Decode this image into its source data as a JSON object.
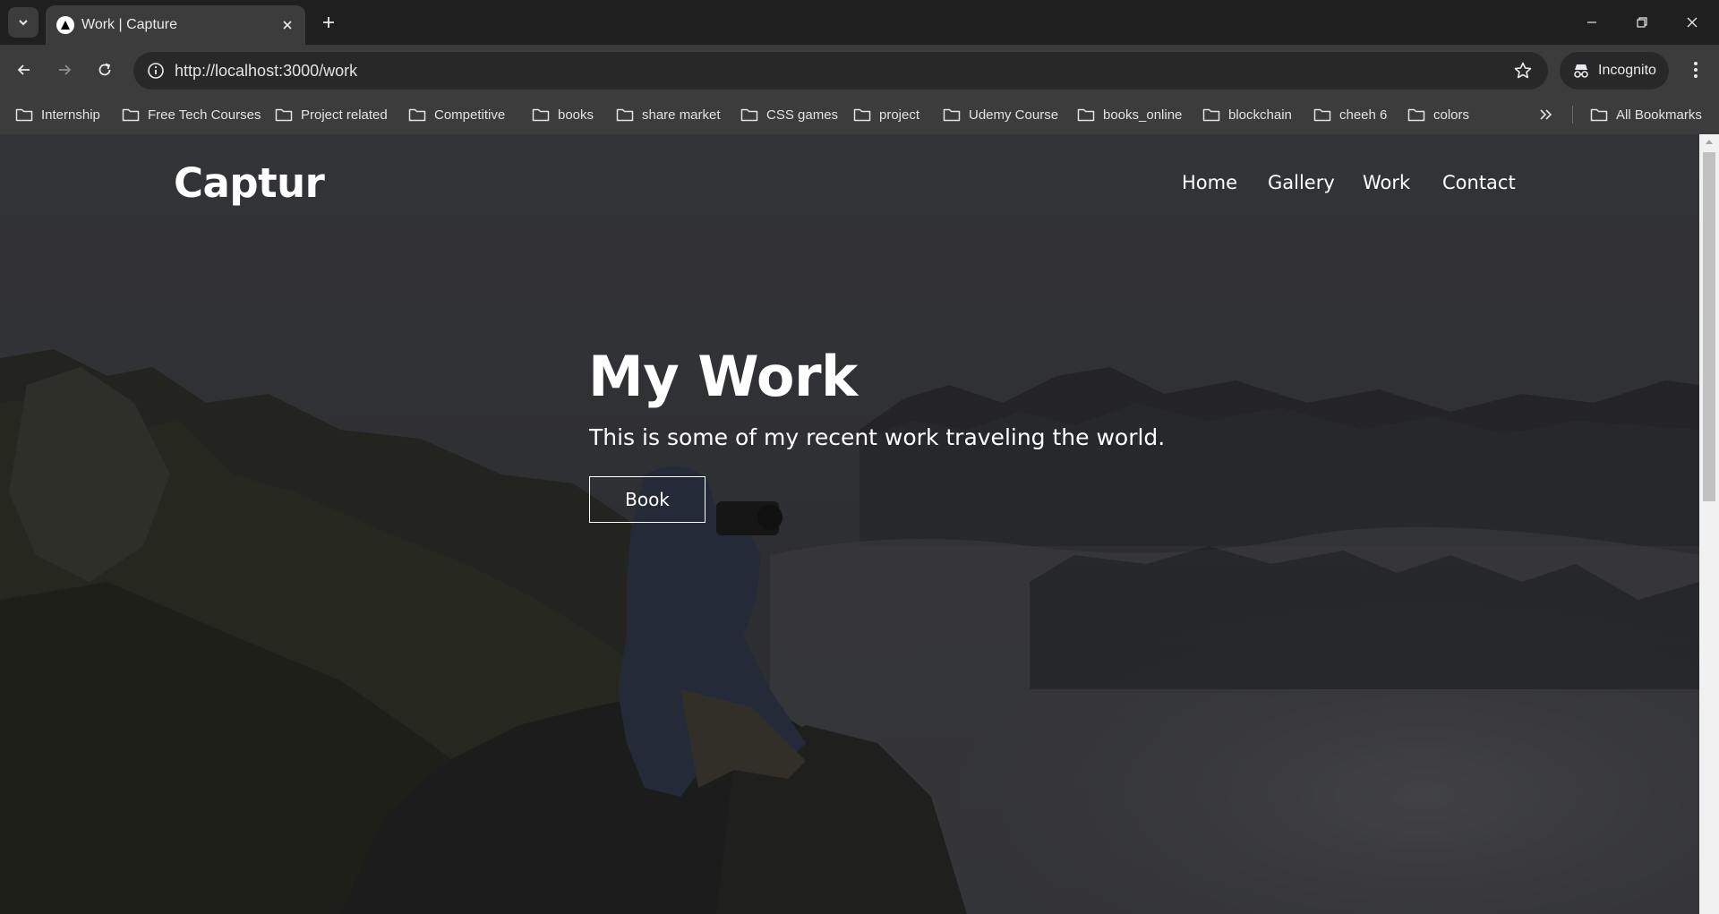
{
  "browser": {
    "tab_title": "Work | Capture",
    "url": "http://localhost:3000/work",
    "incognito_label": "Incognito",
    "bookmarks": [
      "Internship",
      "Free Tech Courses",
      "Project related",
      "Competitive",
      "books",
      "share market",
      "CSS games",
      "project",
      "Udemy Course",
      "books_online",
      "blockchain",
      "cheeh 6",
      "colors"
    ],
    "all_bookmarks_label": "All Bookmarks"
  },
  "site": {
    "logo": "Captur",
    "nav": [
      "Home",
      "Gallery",
      "Work",
      "Contact"
    ]
  },
  "hero": {
    "title": "My Work",
    "subtitle": "This is some of my recent work traveling the world.",
    "button_label": "Book"
  },
  "colors": {
    "overlay": "#000000",
    "text": "#ffffff",
    "chrome_bg": "#3c3c3c",
    "tabstrip_bg": "#1f1f1f"
  }
}
